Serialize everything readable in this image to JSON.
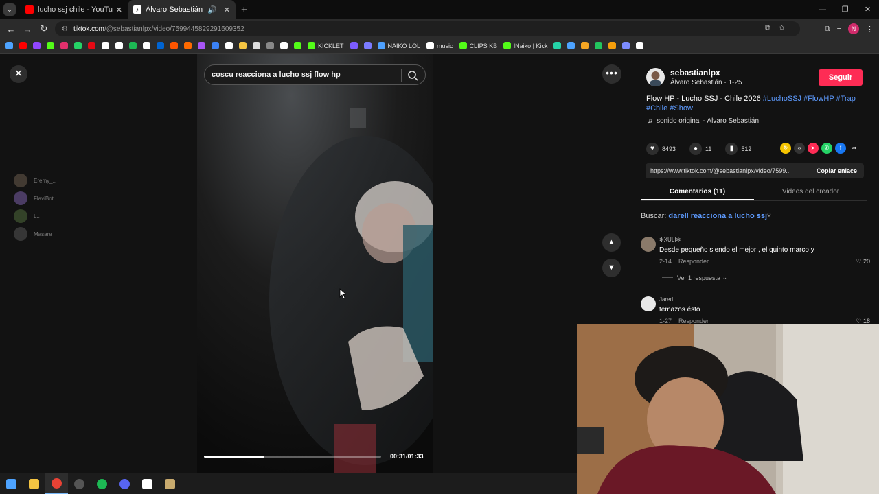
{
  "browser": {
    "tabs": [
      {
        "title": "lucho ssj chile - YouTube",
        "icon": "youtube-icon",
        "active": false
      },
      {
        "title": "Álvaro Sebastián (@sebastianlpx) | TikTok",
        "icon": "tiktok-icon",
        "active": true
      }
    ],
    "url_host": "tiktok.com",
    "url_path": "/@sebastianlpx/video/7599445829291609352",
    "profile_initial": "N",
    "bookmarks": [
      {
        "label": "",
        "color": "#ff0000"
      },
      {
        "label": "",
        "color": "#9146ff"
      },
      {
        "label": "",
        "color": "#53fc18"
      },
      {
        "label": "",
        "color": "#e1306c"
      },
      {
        "label": "",
        "color": "#25d366"
      },
      {
        "label": "",
        "color": "#e50914"
      },
      {
        "label": "",
        "color": "#ffffff"
      },
      {
        "label": "",
        "color": "#ffffff"
      },
      {
        "label": "",
        "color": "#1db954"
      },
      {
        "label": "",
        "color": "#ffffff"
      },
      {
        "label": "",
        "color": "#0064d2"
      },
      {
        "label": "",
        "color": "#ff5500"
      },
      {
        "label": "",
        "color": "#ff6a00"
      },
      {
        "label": "",
        "color": "#a855f7"
      },
      {
        "label": "",
        "color": "#3b82f6"
      },
      {
        "label": "",
        "color": "#ffffff"
      },
      {
        "label": "",
        "color": "#f5c542"
      },
      {
        "label": "",
        "color": "#dddddd"
      },
      {
        "label": "",
        "color": "#888888"
      },
      {
        "label": "",
        "color": "#ffffff"
      },
      {
        "label": "",
        "color": "#53fc18"
      },
      {
        "label": "KICKLET",
        "color": "#53fc18"
      },
      {
        "label": "",
        "color": "#7c5cff"
      },
      {
        "label": "",
        "color": "#7a7aff"
      },
      {
        "label": "NAIKO LOL",
        "color": "#4ea1ff"
      },
      {
        "label": "music",
        "color": "#ffffff"
      },
      {
        "label": "CLIPS KB",
        "color": "#53fc18"
      },
      {
        "label": "lNaiko | Kick",
        "color": "#53fc18"
      },
      {
        "label": "",
        "color": "#25d3a8"
      },
      {
        "label": "",
        "color": "#4da3ff"
      },
      {
        "label": "",
        "color": "#f5a623"
      },
      {
        "label": "",
        "color": "#22c55e"
      },
      {
        "label": "",
        "color": "#f59e0b"
      },
      {
        "label": "",
        "color": "#7c8cff"
      },
      {
        "label": "",
        "color": "#ffffff"
      }
    ]
  },
  "player": {
    "search_query": "coscu reacciona a lucho ssj flow hp",
    "time": "00:31/01:33",
    "progress": 0.34,
    "viewers": [
      {
        "name": "Eremy_..",
        "color": "#6a5b4d"
      },
      {
        "name": "FlaviBot",
        "color": "#7a5fa8"
      },
      {
        "name": "L..",
        "color": "#4f6a3a"
      },
      {
        "name": "Masare",
        "color": "#555555"
      }
    ]
  },
  "video_info": {
    "username": "sebastianlpx",
    "display_name": "Álvaro Sebastián · 1-25",
    "follow_label": "Seguir",
    "desc_text": "Flow HP - Lucho SSJ - Chile 2026 ",
    "hashtags": [
      "#LuchoSSJ",
      "#FlowHP",
      "#Trap",
      "#Chile",
      "#Show"
    ],
    "sound": "sonido original - Álvaro Sebastián",
    "likes": "8493",
    "comments_count": "11",
    "saves": "512",
    "link": "https://www.tiktok.com/@sebastianlpx/video/7599...",
    "copy_label": "Copiar enlace"
  },
  "tabs": {
    "comments": "Comentarios (11)",
    "creator_videos": "Videos del creador"
  },
  "search_suggest": {
    "prefix": "Buscar:",
    "query": "darell reacciona a lucho ssj"
  },
  "comments": [
    {
      "user": "XULI",
      "text": "Desde pequeño siendo el mejor , el quinto marco y",
      "date": "2-14",
      "reply": "Responder",
      "likes": "20"
    },
    {
      "user": "Jared",
      "text": "temazos ésto",
      "date": "1-27",
      "reply": "Responder",
      "likes": "18"
    }
  ],
  "view_replies": "Ver 1 respuesta",
  "taskbar": [
    {
      "name": "start-icon",
      "color": "#4da3ff"
    },
    {
      "name": "explorer-icon",
      "color": "#f5c542"
    },
    {
      "name": "chrome-icon",
      "color": "#e94235"
    },
    {
      "name": "obs-icon",
      "color": "#555555"
    },
    {
      "name": "spotify-icon",
      "color": "#1db954"
    },
    {
      "name": "discord-icon",
      "color": "#5865f2"
    },
    {
      "name": "app-icon",
      "color": "#ffffff"
    },
    {
      "name": "league-icon",
      "color": "#c8aa6e"
    }
  ]
}
